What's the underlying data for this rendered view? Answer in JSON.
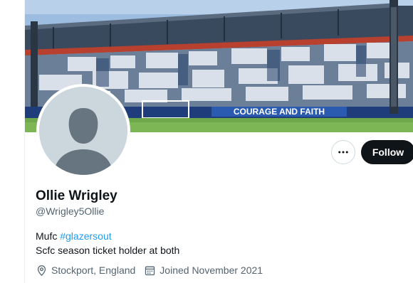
{
  "profile": {
    "display_name": "Ollie Wrigley",
    "handle": "@Wrigley5Ollie",
    "bio_word": "Mufc",
    "bio_hashtag": "#glazersout",
    "bio_line2": "Scfc season ticket holder at both",
    "location": "Stockport, England",
    "joined": "Joined November 2021"
  },
  "banner": {
    "banner_text": "COURAGE AND FAITH"
  },
  "actions": {
    "follow_label": "Follow",
    "more_icon": "more-horizontal-icon"
  },
  "icons": {
    "location": "location-pin-icon",
    "calendar": "calendar-icon"
  },
  "colors": {
    "link": "#1d9bf0",
    "follow_bg": "#0f1419",
    "muted": "#536471"
  }
}
